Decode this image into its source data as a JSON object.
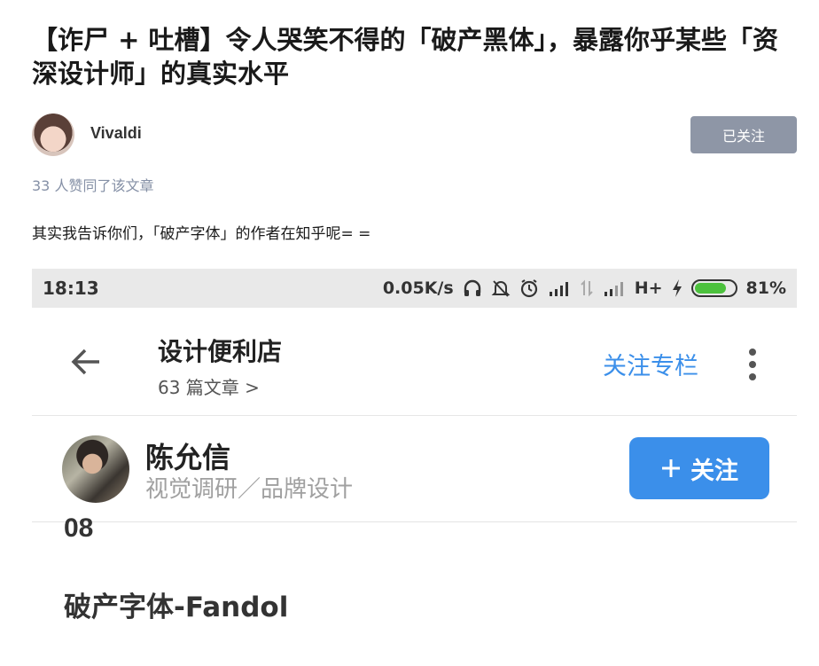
{
  "article": {
    "title": "【诈尸 + 吐槽】令人哭笑不得的「破产黑体」，暴露你乎某些「资深设计师」的真实水平",
    "author_name": "Vivaldi",
    "follow_button": "已关注",
    "likes": "33 人赞同了该文章",
    "paragraph": "其实我告诉你们，「破产字体」的作者在知乎呢= ="
  },
  "screenshot": {
    "status_bar": {
      "time": "18:13",
      "speed": "0.05K/s",
      "network": "H+",
      "battery": "81%",
      "battery_level": 0.81,
      "battery_color": "#4cc13d"
    },
    "app_bar": {
      "column_title": "设计便利店",
      "column_sub": "63 篇文章 >",
      "follow_column": "关注专栏",
      "accent_color": "#3b8fea"
    },
    "author": {
      "name": "陈允信",
      "description": "视觉调研／品牌设计",
      "follow_button": "关注"
    },
    "partial_text": "08",
    "article_heading": "破产字体-Fandol"
  }
}
